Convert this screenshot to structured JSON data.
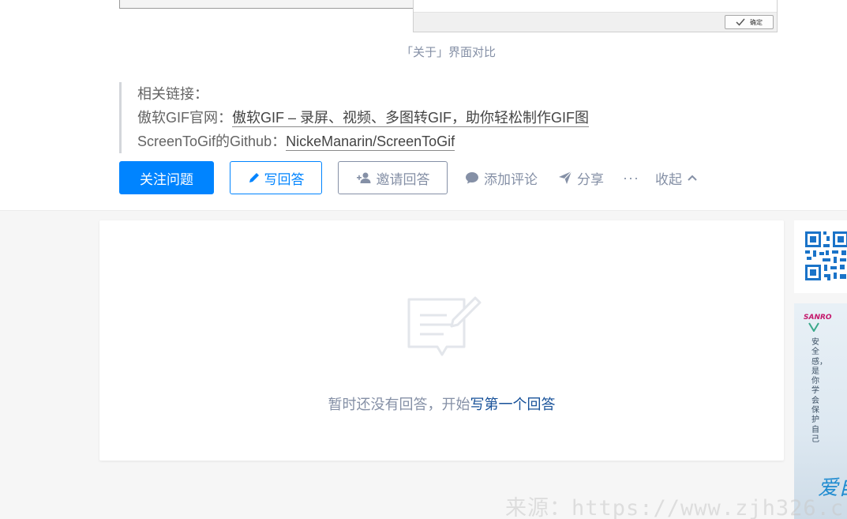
{
  "shot": {
    "ok_label": "确定"
  },
  "caption": "「关于」界面对比",
  "links": {
    "heading": "相关链接：",
    "official_prefix": "傲软GIF官网：",
    "official_link": "傲软GIF – 录屏、视频、多图转GIF，助你轻松制作GIF图",
    "github_prefix": "ScreenToGif的Github：",
    "github_link": "NickeManarin/ScreenToGif"
  },
  "actions": {
    "follow": "关注问题",
    "write": "写回答",
    "invite": "邀请回答",
    "comment": "添加评论",
    "share": "分享",
    "more": "···",
    "collapse": "收起"
  },
  "answers": {
    "empty_text": "暂时还没有回答，开始",
    "empty_link": "写第一个回答"
  },
  "side_ad": {
    "logo": "SANRO",
    "tagline": "安全感，是你学会保护自己",
    "script": "爱自己"
  },
  "watermark": "来源：https://www.zjh326.c",
  "colors": {
    "primary": "#0084ff",
    "muted": "#8590a6",
    "link": "#175199",
    "page_bg": "#f6f6f6"
  }
}
